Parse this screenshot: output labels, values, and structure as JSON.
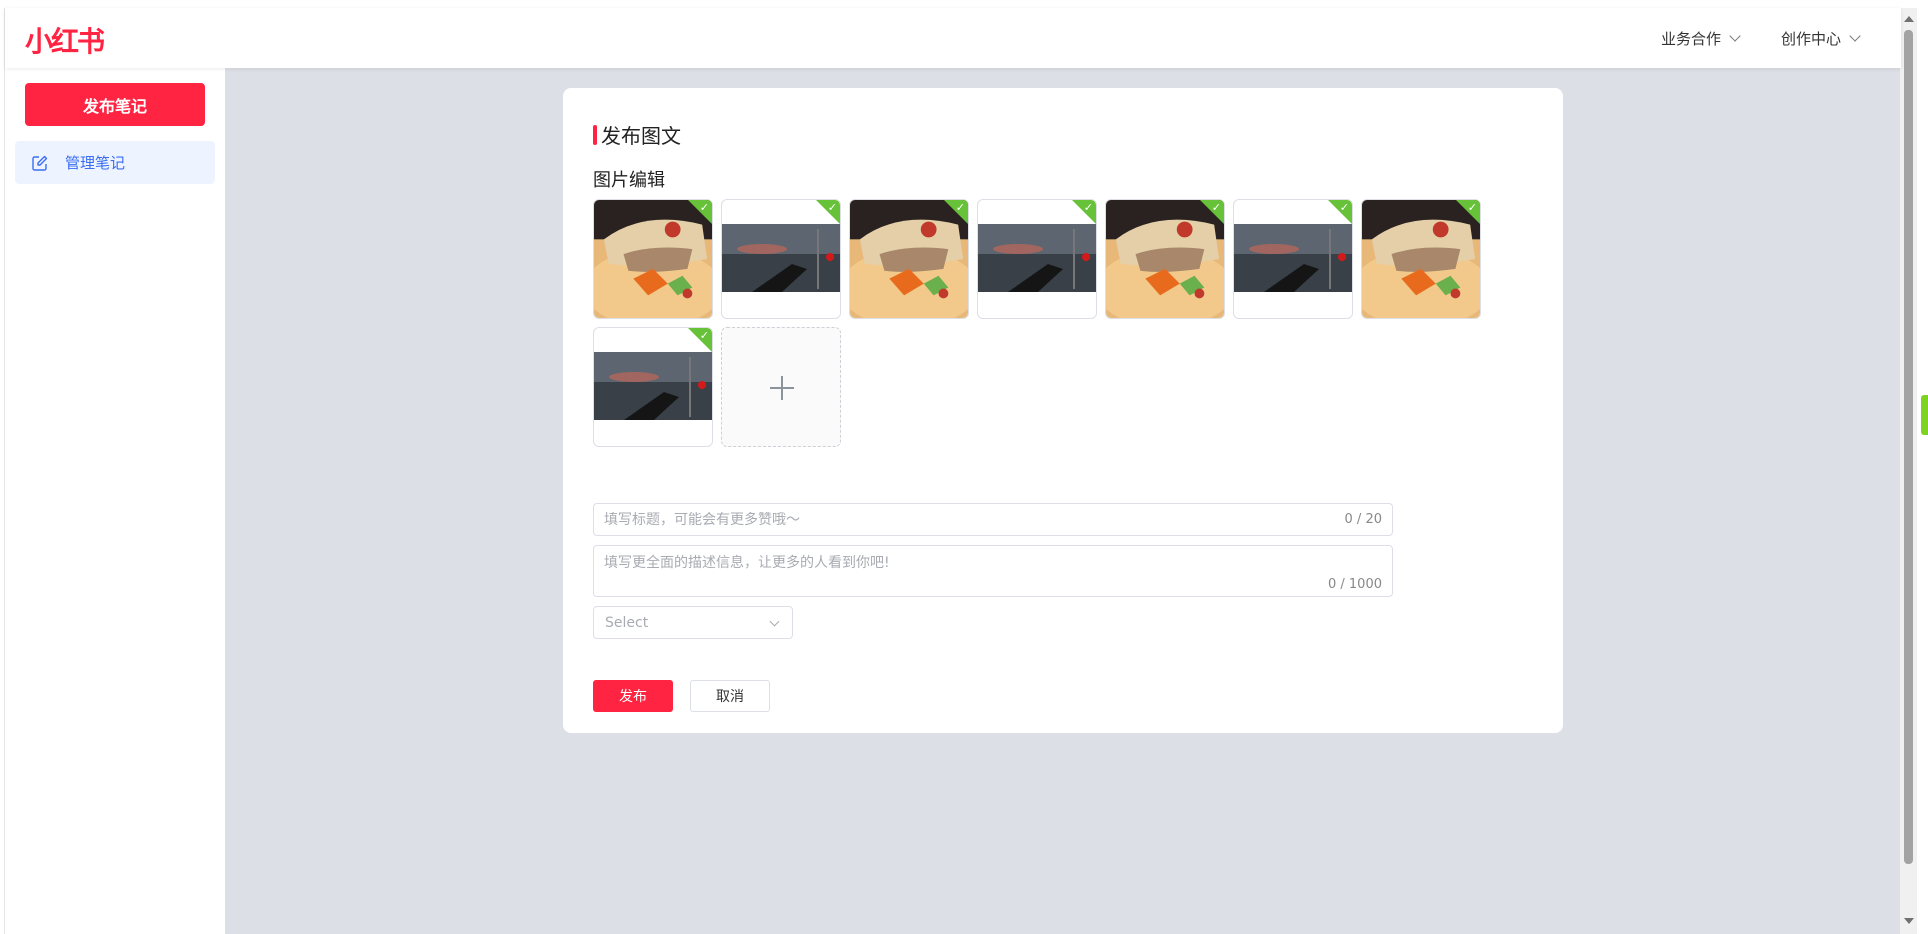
{
  "header": {
    "logo": "小红书",
    "menus": [
      {
        "label": "业务合作"
      },
      {
        "label": "创作中心"
      }
    ]
  },
  "sidebar": {
    "publish_button": "发布笔记",
    "items": [
      {
        "label": "管理笔记",
        "icon": "edit-icon"
      }
    ]
  },
  "card": {
    "title": "发布图文",
    "section_title": "图片编辑",
    "images": [
      {
        "type": "food-photo",
        "selected": true
      },
      {
        "type": "dark-lake-photo",
        "selected": true
      },
      {
        "type": "food-photo",
        "selected": true
      },
      {
        "type": "dark-lake-photo",
        "selected": true
      },
      {
        "type": "food-photo",
        "selected": true
      },
      {
        "type": "dark-lake-photo",
        "selected": true
      },
      {
        "type": "food-photo",
        "selected": true
      },
      {
        "type": "dark-lake-photo",
        "selected": true
      }
    ],
    "title_input": {
      "placeholder": "填写标题，可能会有更多赞哦～",
      "value": "",
      "counter": "0 / 20"
    },
    "desc_input": {
      "placeholder": "填写更全面的描述信息，让更多的人看到你吧!",
      "value": "",
      "counter": "0 / 1000"
    },
    "select": {
      "placeholder": "Select"
    },
    "publish_label": "发布",
    "cancel_label": "取消"
  },
  "colors": {
    "brand": "#ff2442",
    "accent": "#3a6cf4",
    "check": "#67c23a",
    "background": "#dcdfe6"
  }
}
